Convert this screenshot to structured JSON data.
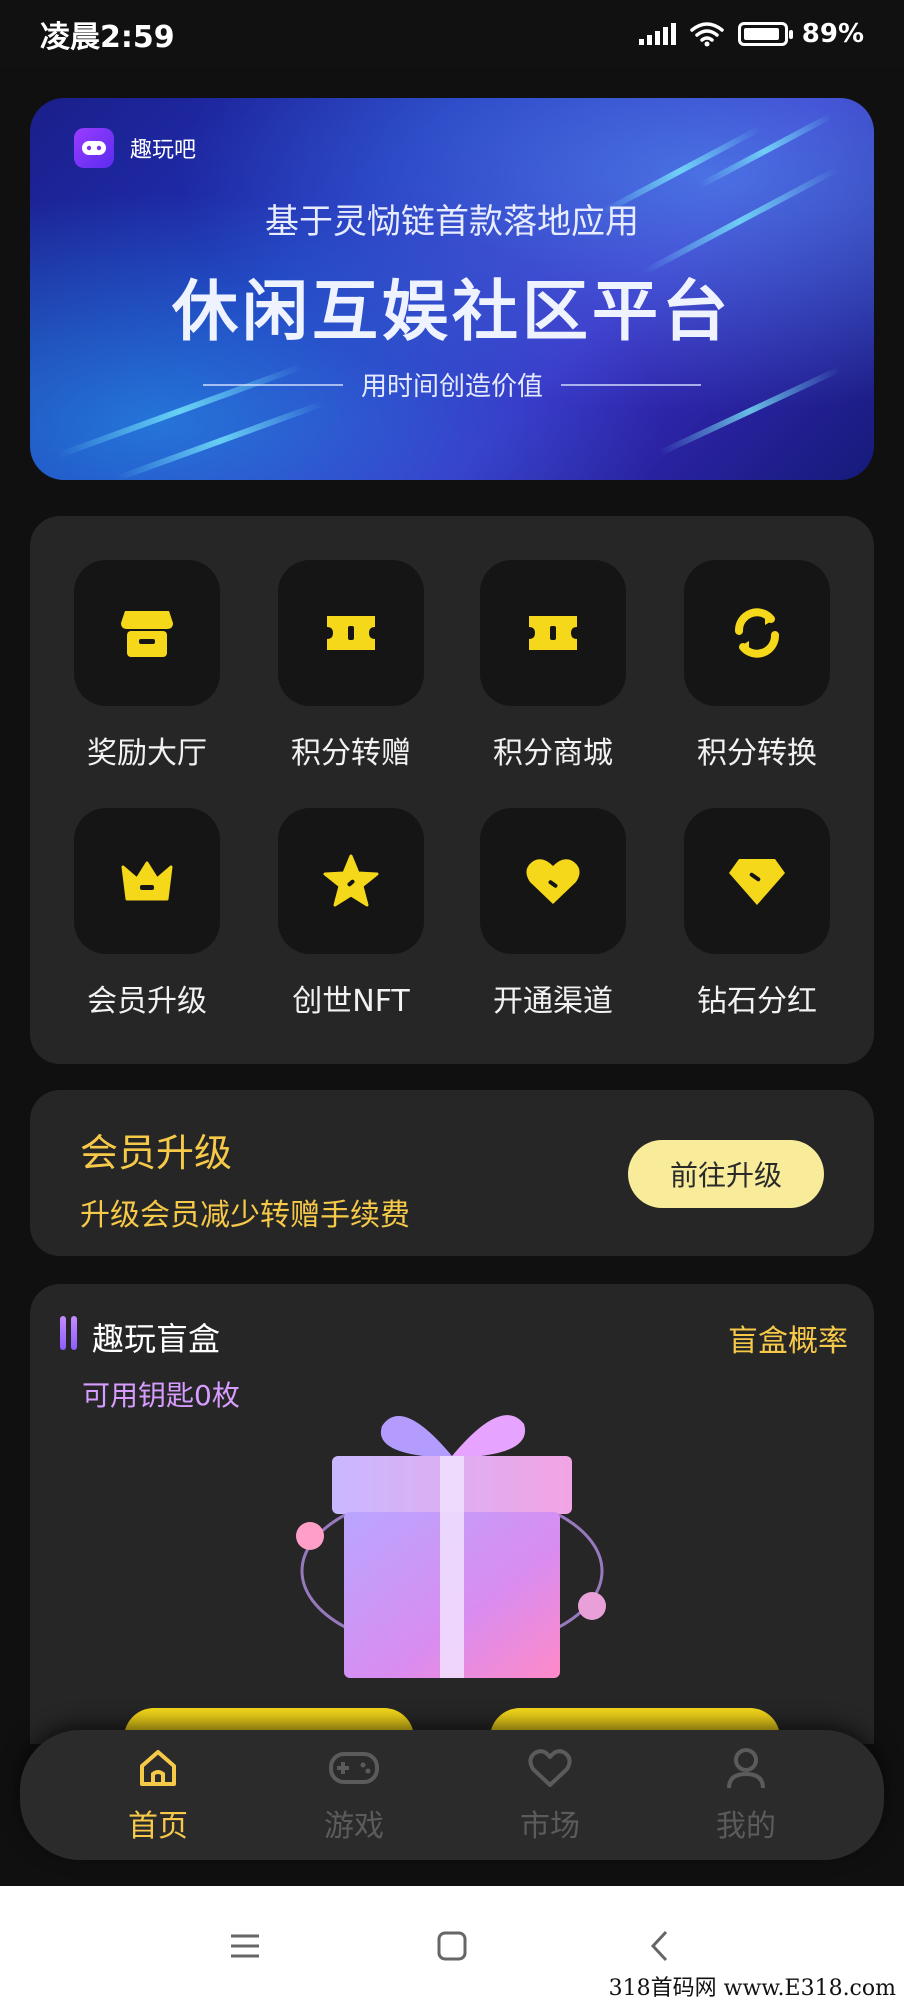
{
  "status_bar": {
    "time": "凌晨2:59",
    "battery": "89%"
  },
  "banner": {
    "brand": "趣玩吧",
    "subtitle": "基于灵恸链首款落地应用",
    "title": "休闲互娱社区平台",
    "slogan": "用时间创造价值"
  },
  "grid": {
    "items": [
      {
        "label": "奖励大厅",
        "icon": "shop-icon"
      },
      {
        "label": "积分转赠",
        "icon": "ticket-icon"
      },
      {
        "label": "积分商城",
        "icon": "ticket-icon"
      },
      {
        "label": "积分转换",
        "icon": "refresh-icon"
      },
      {
        "label": "会员升级",
        "icon": "crown-icon"
      },
      {
        "label": "创世NFT",
        "icon": "star-icon"
      },
      {
        "label": "开通渠道",
        "icon": "heart-icon"
      },
      {
        "label": "钻石分红",
        "icon": "diamond-icon"
      }
    ]
  },
  "upgrade": {
    "title": "会员升级",
    "description": "升级会员减少转赠手续费",
    "button": "前往升级"
  },
  "blind_box": {
    "title": "趣玩盲盒",
    "probability_link": "盲盒概率",
    "keys": "可用钥匙0枚"
  },
  "bottom_nav": {
    "items": [
      {
        "label": "首页",
        "icon": "home-icon",
        "active": true
      },
      {
        "label": "游戏",
        "icon": "gamepad-icon",
        "active": false
      },
      {
        "label": "市场",
        "icon": "heart-icon",
        "active": false
      },
      {
        "label": "我的",
        "icon": "user-icon",
        "active": false
      }
    ]
  },
  "colors": {
    "accent": "#f7c948",
    "card": "#262626",
    "background": "#101010",
    "icon_yellow": "#f5d81a"
  },
  "watermark": "318首码网 www.E318.com"
}
